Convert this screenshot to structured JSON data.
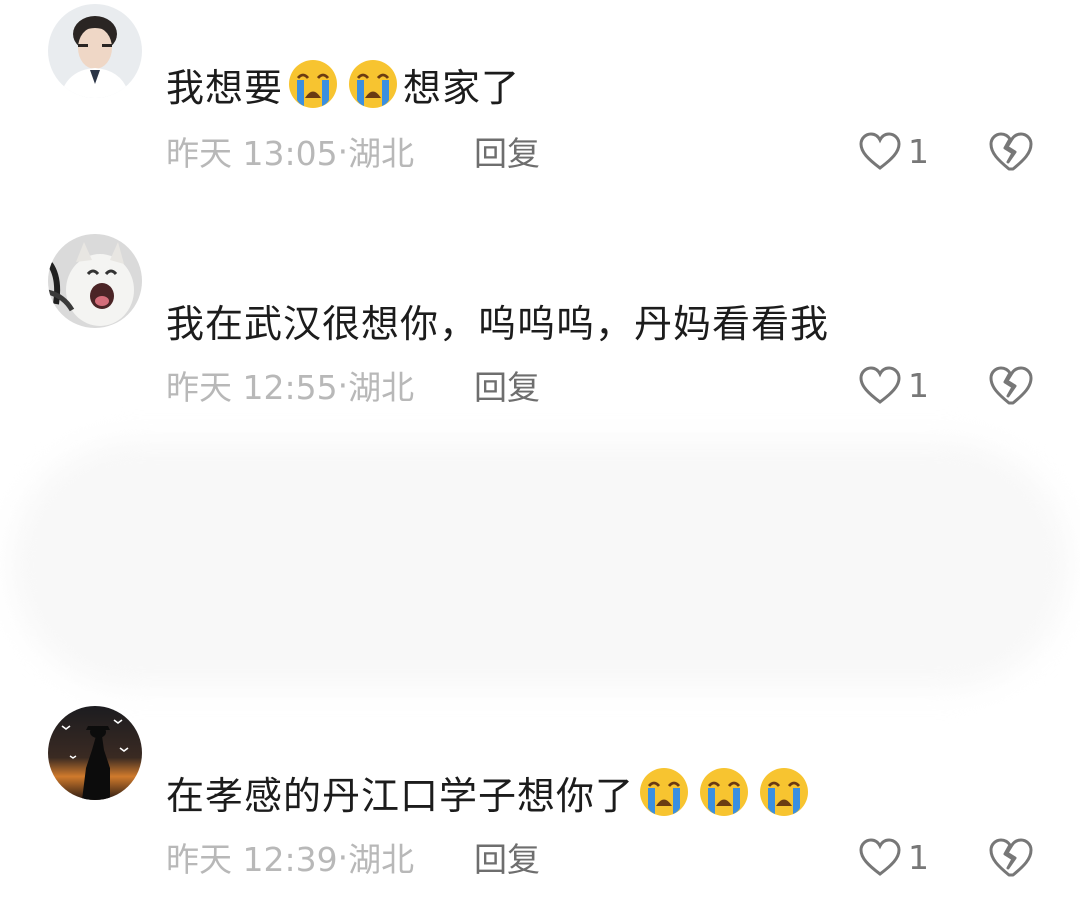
{
  "comments": [
    {
      "text_before": "我想要",
      "emoji_count": 2,
      "emoji_name": "loudly-crying-face",
      "text_after": "想家了",
      "time": "昨天 13:05",
      "location": "湖北",
      "reply_label": "回复",
      "likes": "1"
    },
    {
      "text_before": "我在武汉很想你，呜呜呜，丹妈看看我",
      "emoji_count": 0,
      "text_after": "",
      "time": "昨天 12:55",
      "location": "湖北",
      "reply_label": "回复",
      "likes": "1"
    },
    {
      "text_before": "在孝感的丹江口学子想你了",
      "emoji_count": 3,
      "emoji_name": "loudly-crying-face",
      "text_after": "",
      "time": "昨天 12:39",
      "location": "湖北",
      "reply_label": "回复",
      "likes": "1"
    }
  ],
  "icons": {
    "like": "heart-outline-icon",
    "dislike": "broken-heart-icon"
  },
  "colors": {
    "text": "#1c1c1c",
    "meta": "#b8b8b8",
    "reply": "#6e6e6e",
    "emoji_face": "#f7c430",
    "emoji_tears": "#3a8fe0"
  }
}
